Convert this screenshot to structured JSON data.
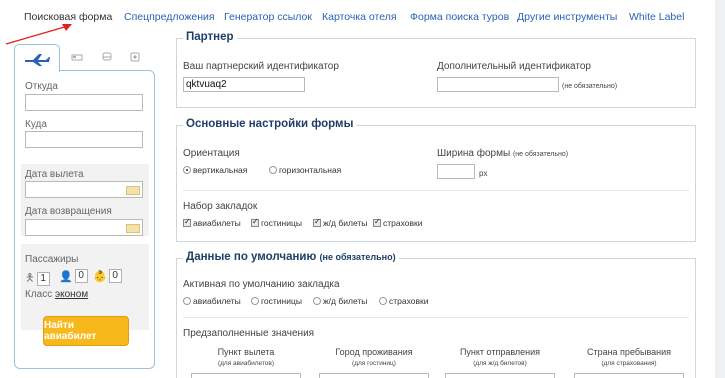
{
  "nav": {
    "tabs": [
      "Поисковая форма",
      "Спецпредложения",
      "Генератор ссылок",
      "Карточка отеля",
      "Форма поиска туров",
      "Другие инструменты",
      "White Label"
    ]
  },
  "widget": {
    "from_label": "Откуда",
    "to_label": "Куда",
    "departure_label": "Дата вылета",
    "return_label": "Дата возвращения",
    "passengers_label": "Пассажиры",
    "adults": "1",
    "children": "0",
    "infants": "0",
    "class_label": "Класс",
    "class_value": "эконом",
    "search_button": "Найти авиабилет"
  },
  "partner": {
    "legend": "Партнер",
    "id_label": "Ваш партнерский идентификатор",
    "id_value": "qktvuaq2",
    "extra_label": "Дополнительный идентификатор",
    "optional": "(не обязательно)"
  },
  "main_settings": {
    "legend": "Основные настройки формы",
    "orientation_label": "Ориентация",
    "vertical": "вертикальная",
    "horizontal": "горизонтальная",
    "width_label": "Ширина формы",
    "width_note": "(не обязательно)",
    "px": "px",
    "tabs_label": "Набор закладок",
    "tab_options": [
      "авиабилеты",
      "гостиницы",
      "ж/д билеты",
      "страховки"
    ]
  },
  "defaults": {
    "legend": "Данные по умолчанию",
    "legend_note": "(не обязательно)",
    "active_tab_label": "Активная по умолчанию закладка",
    "tab_options": [
      "авиабилеты",
      "гостиницы",
      "ж/д билеты",
      "страховки"
    ],
    "prefilled_label": "Предзаполненные значения",
    "columns": [
      {
        "title": "Пункт вылета",
        "sub": "(для авиабилетов)"
      },
      {
        "title": "Город проживания",
        "sub": "(для гостиниц)"
      },
      {
        "title": "Пункт отправления",
        "sub": "(для ж/д билетов)"
      },
      {
        "title": "Страна пребывания",
        "sub": "(для страхования)"
      }
    ]
  },
  "colors": {
    "link": "#2a62b3",
    "legend": "#1e3f66",
    "button": "#f7b81c",
    "border": "#9cc0dd"
  }
}
